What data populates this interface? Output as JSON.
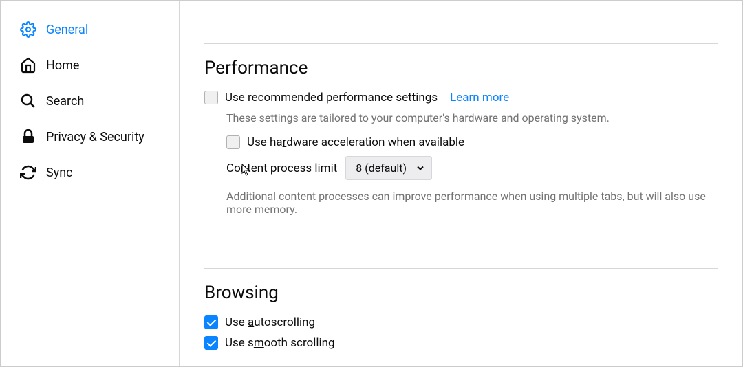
{
  "sidebar": {
    "items": [
      {
        "label": "General",
        "active": true
      },
      {
        "label": "Home",
        "active": false
      },
      {
        "label": "Search",
        "active": false
      },
      {
        "label": "Privacy & Security",
        "active": false
      },
      {
        "label": "Sync",
        "active": false
      }
    ]
  },
  "performance": {
    "heading": "Performance",
    "recommended_label_pre": "U",
    "recommended_label_post": "se recommended performance settings",
    "recommended_checked": false,
    "learn_more": "Learn more",
    "description": "These settings are tailored to your computer's hardware and operating system.",
    "hardware_label_pre": "Use ha",
    "hardware_label_key": "r",
    "hardware_label_post": "dware acceleration when available",
    "hardware_checked": false,
    "content_limit_label_pre": "Content process ",
    "content_limit_label_key": "l",
    "content_limit_label_post": "imit",
    "content_limit_value": "8 (default)",
    "additional_info": "Additional content processes can improve performance when using multiple tabs, but will also use more memory."
  },
  "browsing": {
    "heading": "Browsing",
    "autoscroll_label_pre": "Use ",
    "autoscroll_label_key": "a",
    "autoscroll_label_post": "utoscrolling",
    "autoscroll_checked": true,
    "smooth_label_pre": "Use s",
    "smooth_label_key": "m",
    "smooth_label_post": "ooth scrolling",
    "smooth_checked": true
  }
}
